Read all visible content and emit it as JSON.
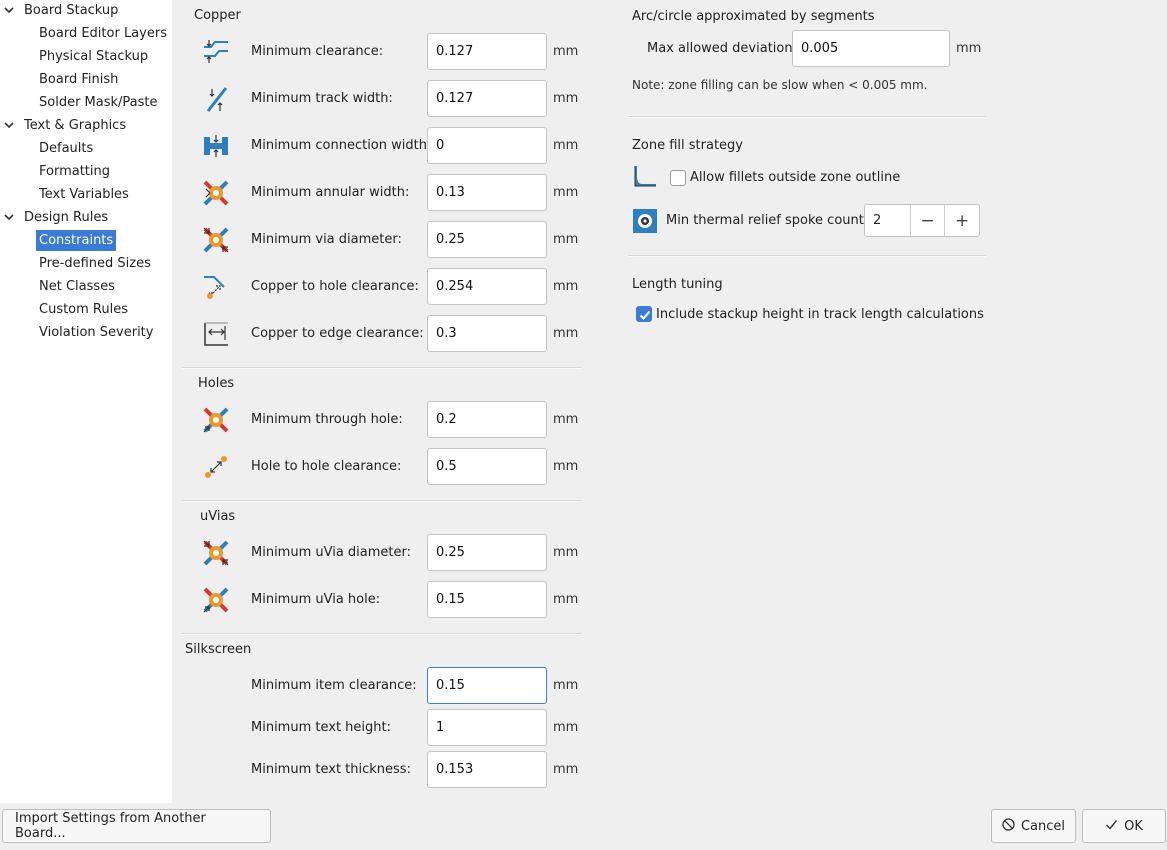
{
  "sidebar": {
    "items": [
      {
        "label": "Board Stackup",
        "level": 0,
        "expanded": true
      },
      {
        "label": "Board Editor Layers",
        "level": 1
      },
      {
        "label": "Physical Stackup",
        "level": 1
      },
      {
        "label": "Board Finish",
        "level": 1
      },
      {
        "label": "Solder Mask/Paste",
        "level": 1
      },
      {
        "label": "Text & Graphics",
        "level": 0,
        "expanded": true
      },
      {
        "label": "Defaults",
        "level": 1
      },
      {
        "label": "Formatting",
        "level": 1
      },
      {
        "label": "Text Variables",
        "level": 1
      },
      {
        "label": "Design Rules",
        "level": 0,
        "expanded": true
      },
      {
        "label": "Constraints",
        "level": 1,
        "selected": true
      },
      {
        "label": "Pre-defined Sizes",
        "level": 1
      },
      {
        "label": "Net Classes",
        "level": 1
      },
      {
        "label": "Custom Rules",
        "level": 1
      },
      {
        "label": "Violation Severity",
        "level": 1
      }
    ]
  },
  "unit": "mm",
  "copper": {
    "title": "Copper",
    "rows": [
      {
        "label": "Minimum clearance:",
        "value": "0.127",
        "icon": "clearance-icon"
      },
      {
        "label": "Minimum track width:",
        "value": "0.127",
        "icon": "track-width-icon"
      },
      {
        "label": "Minimum connection width:",
        "value": "0",
        "icon": "connection-width-icon"
      },
      {
        "label": "Minimum annular width:",
        "value": "0.13",
        "icon": "annular-width-icon"
      },
      {
        "label": "Minimum via diameter:",
        "value": "0.25",
        "icon": "via-diameter-icon"
      },
      {
        "label": "Copper to hole clearance:",
        "value": "0.254",
        "icon": "hole-clearance-icon"
      },
      {
        "label": "Copper to edge clearance:",
        "value": "0.3",
        "icon": "edge-clearance-icon"
      }
    ]
  },
  "holes": {
    "title": "Holes",
    "rows": [
      {
        "label": "Minimum through hole:",
        "value": "0.2",
        "icon": "through-hole-icon"
      },
      {
        "label": "Hole to hole clearance:",
        "value": "0.5",
        "icon": "hole-to-hole-icon"
      }
    ]
  },
  "uvias": {
    "title": "uVias",
    "rows": [
      {
        "label": "Minimum uVia diameter:",
        "value": "0.25",
        "icon": "uvia-diameter-icon"
      },
      {
        "label": "Minimum uVia hole:",
        "value": "0.15",
        "icon": "uvia-hole-icon"
      }
    ]
  },
  "silkscreen": {
    "title": "Silkscreen",
    "rows": [
      {
        "label": "Minimum item clearance:",
        "value": "0.15"
      },
      {
        "label": "Minimum text height:",
        "value": "1"
      },
      {
        "label": "Minimum text thickness:",
        "value": "0.153"
      }
    ]
  },
  "arc": {
    "title": "Arc/circle approximated by segments",
    "label": "Max allowed deviation:",
    "value": "0.005",
    "note": "Note: zone filling can be slow when < 0.005 mm."
  },
  "zone": {
    "title": "Zone fill strategy",
    "fillets_label": "Allow fillets outside zone outline",
    "fillets_checked": false,
    "spoke_label": "Min thermal relief spoke count:",
    "spoke_value": "2",
    "minus": "−",
    "plus": "+"
  },
  "length": {
    "title": "Length tuning",
    "stackup_label": "Include stackup height in track length calculations",
    "stackup_checked": true
  },
  "buttons": {
    "import": "Import Settings from Another Board...",
    "cancel": "Cancel",
    "ok": "OK"
  },
  "colors": {
    "accent": "#3a7bd5",
    "icon_blue": "#2d7fc1",
    "icon_orange": "#e89a2c",
    "icon_red": "#d6382f"
  }
}
